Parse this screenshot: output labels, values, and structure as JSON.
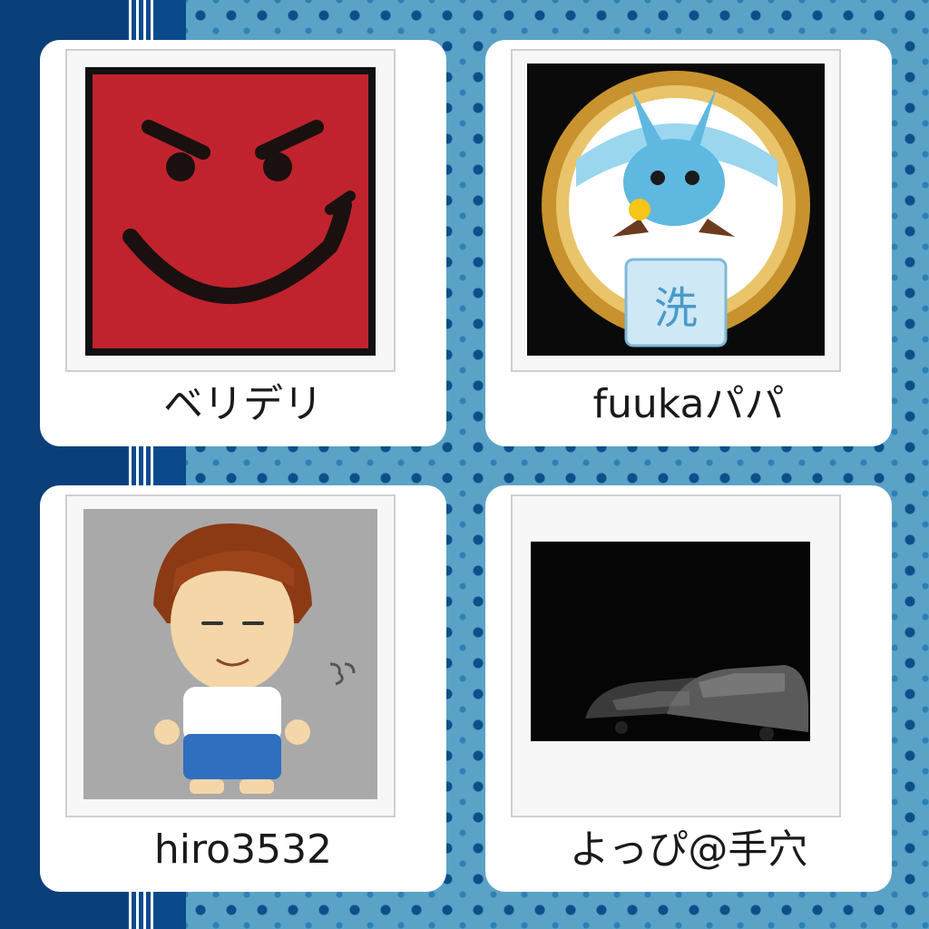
{
  "users": [
    {
      "name": "ベリデリ",
      "avatar": "devil-smile-avatar"
    },
    {
      "name": "fuukaパパ",
      "avatar": "blue-rabbit-medal-avatar"
    },
    {
      "name": "hiro3532",
      "avatar": "cartoon-boy-avatar"
    },
    {
      "name": "よっぴ@手穴",
      "avatar": "dark-cars-avatar"
    }
  ],
  "colors": {
    "page_background": "#5aa3c6",
    "stripe": "#0a4a8c",
    "card": "#ffffff"
  }
}
